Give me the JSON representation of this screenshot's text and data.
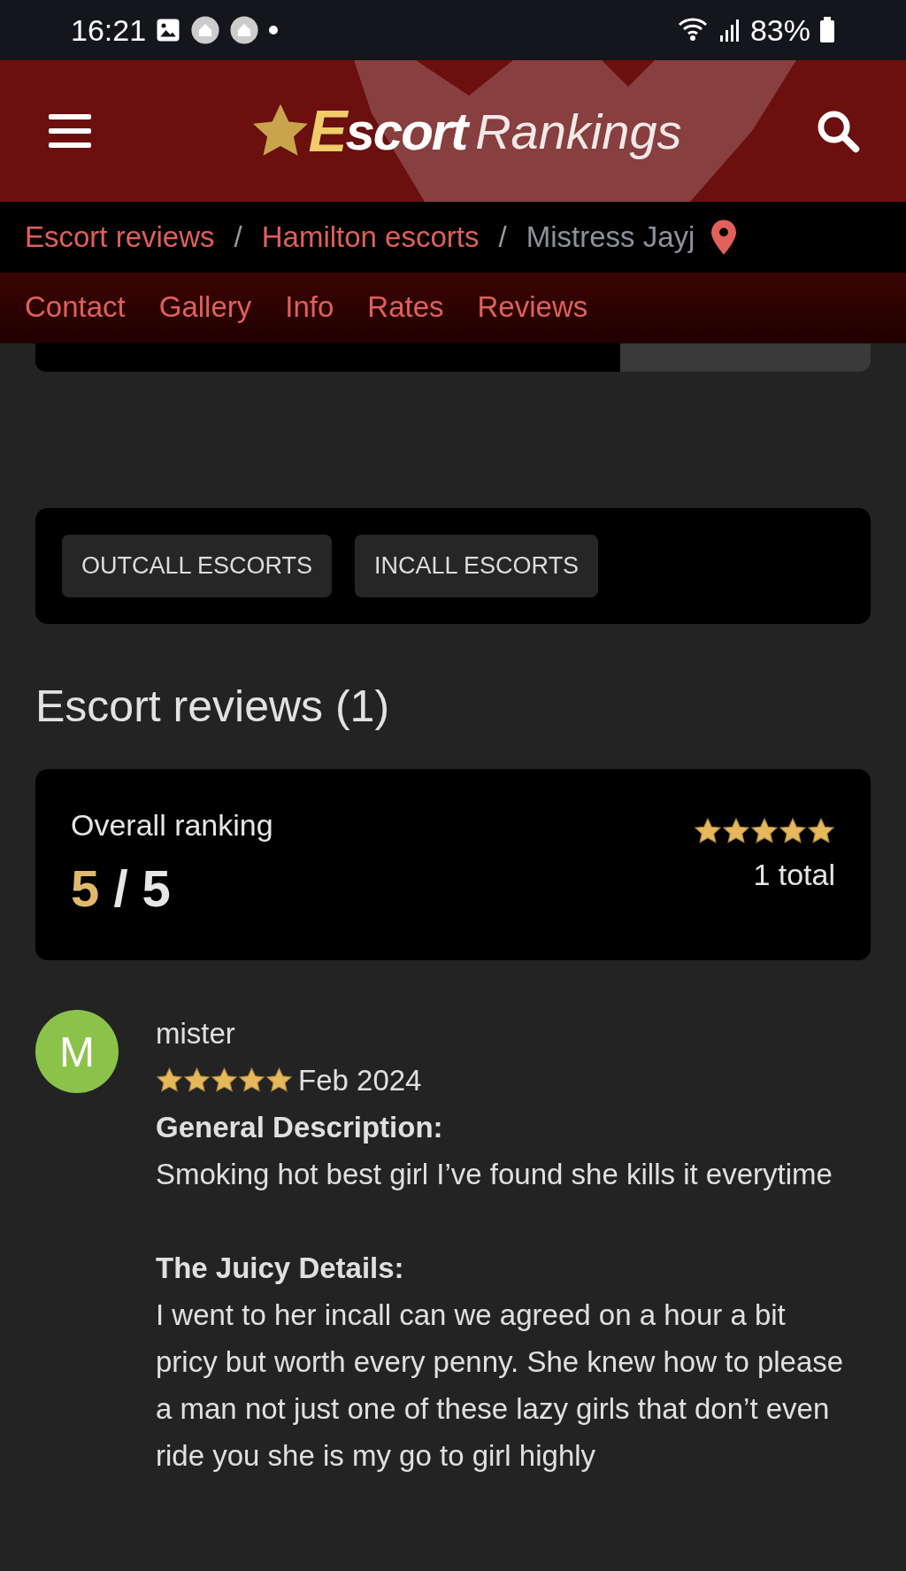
{
  "status_bar": {
    "time": "16:21",
    "battery": "83%"
  },
  "header": {
    "logo": {
      "initial": "E",
      "bold": "scort",
      "light": "Rankings"
    }
  },
  "breadcrumb_separator": "/",
  "breadcrumbs": [
    {
      "label": "Escort reviews",
      "current": false
    },
    {
      "label": "Hamilton escorts",
      "current": false
    },
    {
      "label": "Mistress Jayj",
      "current": true
    }
  ],
  "tabs": [
    {
      "label": "Contact",
      "selected": false
    },
    {
      "label": "Gallery",
      "selected": false
    },
    {
      "label": "Info",
      "selected": false
    },
    {
      "label": "Rates",
      "selected": false
    },
    {
      "label": "Reviews",
      "selected": false
    }
  ],
  "tags": [
    "OUTCALL ESCORTS",
    "INCALL ESCORTS"
  ],
  "reviews_heading": "Escort reviews (1)",
  "overall": {
    "label": "Overall ranking",
    "score": "5",
    "out_of": "/ 5",
    "stars": 5,
    "total": "1 total"
  },
  "review": {
    "initial": "M",
    "author": "mister",
    "stars": 5,
    "date": "Feb 2024",
    "sections": [
      {
        "heading": "General Description:",
        "body": "Smoking hot best girl I’ve found she kills it everytime"
      },
      {
        "heading": "The Juicy Details:",
        "body": "I went to her incall can we agreed on a hour a bit pricy but worth every penny. She knew how to please a man not just one of these lazy girls that don’t even ride you she is my go to girl highly"
      }
    ]
  }
}
